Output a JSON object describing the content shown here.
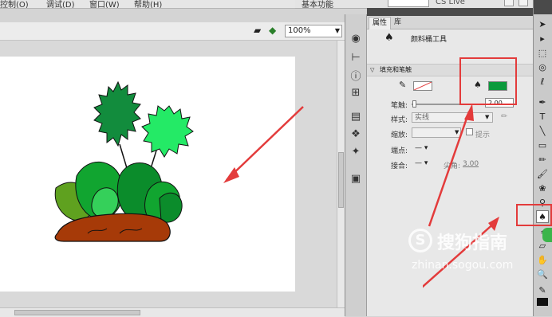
{
  "menubar": {
    "items": [
      "控制(O)",
      "调试(D)",
      "窗口(W)",
      "帮助(H)"
    ]
  },
  "topbar": {
    "workspace": "基本功能",
    "cs_live": "CS Live"
  },
  "stage": {
    "zoom_value": "100%"
  },
  "properties": {
    "tabs": [
      "属性",
      "库"
    ],
    "tool_title": "颜料桶工具",
    "section_title": "填充和笔触",
    "stroke_label": "笔触:",
    "stroke_value": "2.00",
    "style_label": "样式:",
    "style_value": "实线",
    "scale_label": "缩放:",
    "hint_label": "提示",
    "cap_label": "端点:",
    "join_label": "接合:",
    "miter_label": "尖角:",
    "miter_value": "3.00"
  },
  "colors": {
    "accent_red": "#e33b3b",
    "fill_swatch": "#0c9a3c",
    "soil": "#a63a08",
    "leaf_dark": "#0b8c2b",
    "leaf_mid": "#11a530",
    "leaf_light": "#35d05a",
    "grass_olive": "#5fa11f",
    "flower_dark": "#128c3d",
    "flower_light": "#24ea66"
  },
  "watermark": {
    "brand": "搜狗指南",
    "url": "zhinan.sogou.com"
  },
  "icons": [
    "arrow-icon",
    "subselect-icon",
    "transform-icon",
    "3d-rotate-icon",
    "lasso-icon",
    "pen-icon",
    "text-icon",
    "line-icon",
    "rectangle-icon",
    "pencil-icon",
    "brush-icon",
    "deco-icon",
    "bone-icon",
    "paint-bucket-icon",
    "eyedropper-icon",
    "eraser-icon",
    "hand-icon",
    "zoom-icon",
    "stroke-color-icon",
    "fill-color-icon"
  ]
}
